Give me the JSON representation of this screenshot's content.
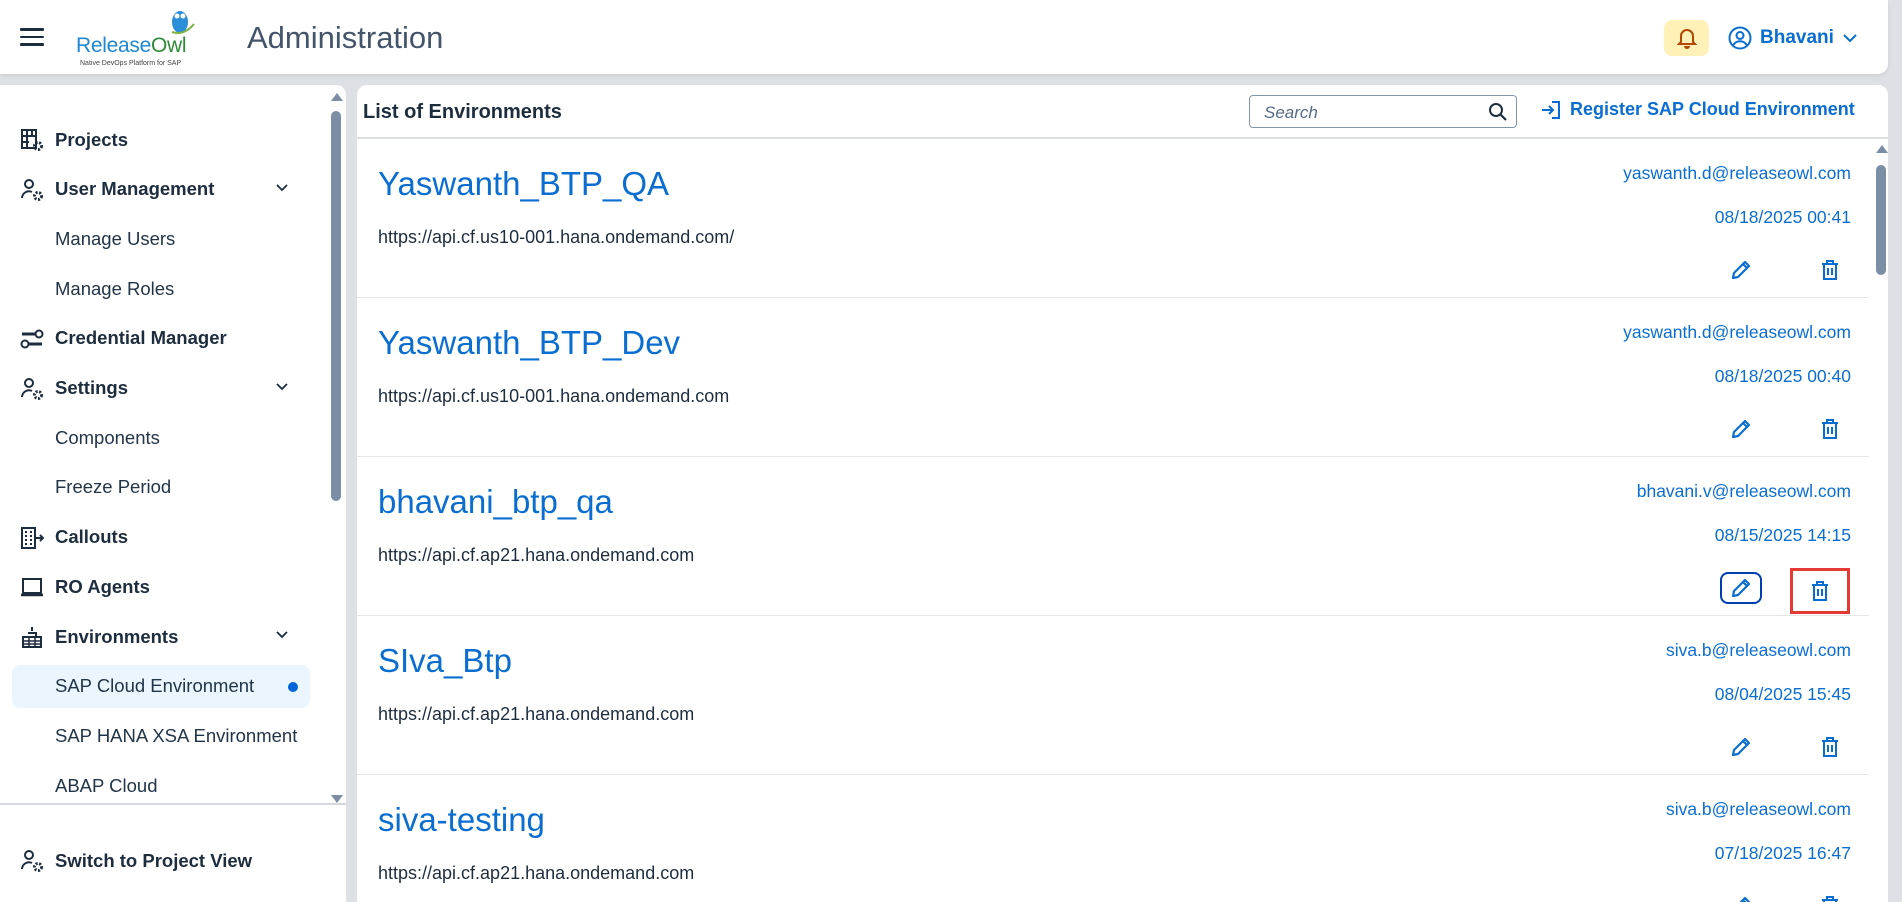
{
  "header": {
    "title": "Administration",
    "logo_text": "ReleaseOwl",
    "logo_tagline": "Native DevOps Platform for SAP",
    "user_name": "Bhavani"
  },
  "sidebar": {
    "items": [
      {
        "label": "Projects",
        "icon": "projects-icon",
        "type": "main"
      },
      {
        "label": "User Management",
        "icon": "user-settings-icon",
        "type": "main",
        "expanded": true
      },
      {
        "label": "Manage Users",
        "type": "sub"
      },
      {
        "label": "Manage Roles",
        "type": "sub"
      },
      {
        "label": "Credential Manager",
        "icon": "keys-icon",
        "type": "main"
      },
      {
        "label": "Settings",
        "icon": "user-settings-icon",
        "type": "main",
        "expanded": true
      },
      {
        "label": "Components",
        "type": "sub"
      },
      {
        "label": "Freeze Period",
        "type": "sub"
      },
      {
        "label": "Callouts",
        "icon": "building-arrow-icon",
        "type": "main"
      },
      {
        "label": "RO Agents",
        "icon": "laptop-icon",
        "type": "main"
      },
      {
        "label": "Environments",
        "icon": "buildings-icon",
        "type": "main",
        "expanded": true
      },
      {
        "label": "SAP Cloud Environment",
        "type": "sub",
        "selected": true
      },
      {
        "label": "SAP HANA XSA Environment",
        "type": "sub"
      },
      {
        "label": "ABAP Cloud",
        "type": "sub"
      }
    ],
    "footer_label": "Switch to Project View"
  },
  "main": {
    "title": "List of Environments",
    "search_placeholder": "Search",
    "register_label": "Register SAP Cloud Environment",
    "environments": [
      {
        "name": "Yaswanth_BTP_QA",
        "url": "https://api.cf.us10-001.hana.ondemand.com/",
        "email": "yaswanth.d@releaseowl.com",
        "date": "08/18/2025 00:41"
      },
      {
        "name": "Yaswanth_BTP_Dev",
        "url": "https://api.cf.us10-001.hana.ondemand.com",
        "email": "yaswanth.d@releaseowl.com",
        "date": "08/18/2025 00:40"
      },
      {
        "name": "bhavani_btp_qa",
        "url": "https://api.cf.ap21.hana.ondemand.com",
        "email": "bhavani.v@releaseowl.com",
        "date": "08/15/2025 14:15"
      },
      {
        "name": "SIva_Btp",
        "url": "https://api.cf.ap21.hana.ondemand.com",
        "email": "siva.b@releaseowl.com",
        "date": "08/04/2025 15:45"
      },
      {
        "name": "siva-testing",
        "url": "https://api.cf.ap21.hana.ondemand.com",
        "email": "siva.b@releaseowl.com",
        "date": "07/18/2025 16:47"
      }
    ]
  },
  "colors": {
    "accent": "#0a6ed1",
    "highlight": "#e53935",
    "bell_bg": "#fff1b8",
    "selected_bg": "#eaf5fe"
  }
}
